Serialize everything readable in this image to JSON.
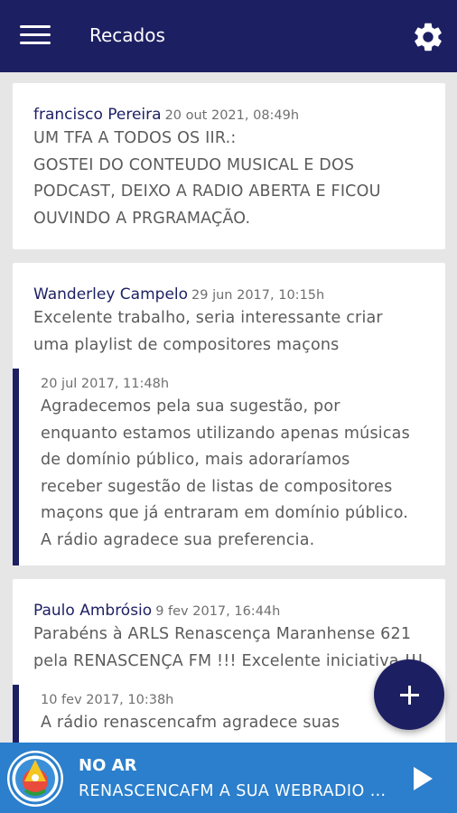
{
  "appbar": {
    "title": "Recados",
    "menu_icon": "menu-icon",
    "settings_icon": "gear-icon"
  },
  "messages": [
    {
      "author": "francisco Pereira",
      "time": "20 out 2021, 08:49h",
      "lines": [
        "UM TFA A TODOS OS IIR.:",
        "GOSTEI DO CONTEUDO MUSICAL E DOS",
        "PODCAST, DEIXO A RADIO ABERTA E FICOU",
        "OUVINDO A PRGRAMAÇÃO."
      ]
    },
    {
      "author": "Wanderley Campelo",
      "time": "29 jun 2017, 10:15h",
      "lines": [
        "Excelente trabalho, seria interessante criar",
        "uma playlist de compositores maçons"
      ],
      "reply": {
        "time": "20 jul 2017, 11:48h",
        "lines": [
          "Agradecemos pela sua sugestão, por",
          "enquanto estamos utilizando apenas músicas",
          "de domínio público, mais adoraríamos",
          "receber sugestão de listas de compositores",
          "maçons que já entraram em domínio público.",
          "A rádio agradece sua preferencia."
        ]
      }
    },
    {
      "author": "Paulo Ambrósio",
      "time": "9 fev 2017, 16:44h",
      "lines": [
        "Parabéns à ARLS Renascença Maranhense 621",
        "pela RENASCENÇA FM !!! Excelente iniciativa !!!"
      ],
      "reply": {
        "time": "10 fev 2017, 10:38h",
        "lines": [
          "A rádio renascencafm agradece suas"
        ]
      }
    }
  ],
  "fab": {
    "icon": "plus-icon"
  },
  "player": {
    "status": "NO AR",
    "station": "RENASCENCAFM A SUA WEBRADIO MAÇÔNICA",
    "play_icon": "play-icon"
  },
  "colors": {
    "primary": "#1d1f63",
    "player": "#2b7fcc",
    "background": "#e6e6e6"
  }
}
